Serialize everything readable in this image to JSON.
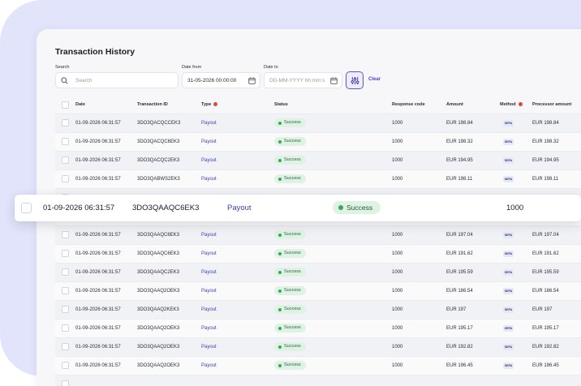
{
  "page": {
    "title": "Transaction History"
  },
  "filters": {
    "search": {
      "label": "Search",
      "placeholder": "Search"
    },
    "date_from": {
      "label": "Date from",
      "value": "31-05-2026 00:00:00"
    },
    "date_to": {
      "label": "Date to",
      "placeholder": "DD-MM-YYYY hh:mm:ss"
    },
    "clear_label": "Clear"
  },
  "table": {
    "headers": {
      "date": "Date",
      "transaction_id": "Transaction ID",
      "type": "Type",
      "status": "Status",
      "response_code": "Response code",
      "amount": "Amount",
      "method": "Method",
      "processor_amount": "Processor amount"
    },
    "rows": [
      {
        "date": "01-09-2026 06:31:57",
        "id": "3DO3QACQCCEK3",
        "type": "Payout",
        "status": "Success",
        "code": "1000",
        "amount": "EUR 198.84",
        "method": "SEPA",
        "processor": "EUR 198.84"
      },
      {
        "date": "01-09-2026 06:31:57",
        "id": "3DO3QACQC6EK3",
        "type": "Payout",
        "status": "Success",
        "code": "1000",
        "amount": "EUR 198.32",
        "method": "SEPA",
        "processor": "EUR 198.32"
      },
      {
        "date": "01-09-2026 06:31:57",
        "id": "3DO3QACQC2EK3",
        "type": "Payout",
        "status": "Success",
        "code": "1000",
        "amount": "EUR 194.95",
        "method": "SEPA",
        "processor": "EUR 194.95"
      },
      {
        "date": "01-09-2026 06:31:57",
        "id": "3DO3QABWS2EK3",
        "type": "Payout",
        "status": "Success",
        "code": "1000",
        "amount": "EUR 198.11",
        "method": "SEPA",
        "processor": "EUR 198.11"
      },
      {
        "date": "",
        "id": "",
        "type": "",
        "status": "",
        "code": "",
        "amount": "",
        "method": "",
        "processor": ""
      },
      {
        "date": "",
        "id": "",
        "type": "",
        "status": "",
        "code": "",
        "amount": "",
        "method": "",
        "processor": ""
      },
      {
        "date": "01-09-2026 06:31:57",
        "id": "3DO3QAAQC6EK3",
        "type": "Payout",
        "status": "Success",
        "code": "1000",
        "amount": "EUR 197.04",
        "method": "SEPA",
        "processor": "EUR 197.04"
      },
      {
        "date": "01-09-2026 06:31:57",
        "id": "3DO3QAAQC6EK3",
        "type": "Payout",
        "status": "Success",
        "code": "1000",
        "amount": "EUR 191.62",
        "method": "SEPA",
        "processor": "EUR 191.62"
      },
      {
        "date": "01-09-2026 06:31:57",
        "id": "3DO3QAAQC2EK3",
        "type": "Payout",
        "status": "Success",
        "code": "1000",
        "amount": "EUR 195.59",
        "method": "SEPA",
        "processor": "EUR 195.59"
      },
      {
        "date": "01-09-2026 06:31:57",
        "id": "3DO3QAAQ2OEK3",
        "type": "Payout",
        "status": "Success",
        "code": "1000",
        "amount": "EUR 186.54",
        "method": "SEPA",
        "processor": "EUR 186.54"
      },
      {
        "date": "01-09-2026 06:31:57",
        "id": "3DO3QAAQ2KEK3",
        "type": "Payout",
        "status": "Success",
        "code": "1000",
        "amount": "EUR 197",
        "method": "SEPA",
        "processor": "EUR 197"
      },
      {
        "date": "01-09-2026 06:31:57",
        "id": "3DO3QAAQ2OEK3",
        "type": "Payout",
        "status": "Success",
        "code": "1000",
        "amount": "EUR 195.17",
        "method": "SEPA",
        "processor": "EUR 195.17"
      },
      {
        "date": "01-09-2026 06:31:57",
        "id": "3DO3QAAQ2OEK3",
        "type": "Payout",
        "status": "Success",
        "code": "1000",
        "amount": "EUR 192.82",
        "method": "SEPA",
        "processor": "EUR 192.82"
      },
      {
        "date": "01-09-2026 06:31:57",
        "id": "3DO3QAAQ2OEK3",
        "type": "Payout",
        "status": "Success",
        "code": "1000",
        "amount": "EUR 196.45",
        "method": "SEPA",
        "processor": "EUR 196.45"
      },
      {
        "date": "",
        "id": "",
        "type": "",
        "status": "",
        "code": "",
        "amount": "",
        "method": "",
        "processor": ""
      }
    ]
  },
  "highlighted_row": {
    "date": "01-09-2026 06:31:57",
    "id": "3DO3QAAQC6EK3",
    "type": "Payout",
    "status": "Success",
    "code": "1000"
  },
  "icons": {
    "search": "search-icon",
    "calendar": "calendar-icon",
    "filter": "filter-sliders-icon",
    "required": "required-dot-icon",
    "method": "sepa-logo-icon"
  },
  "colors": {
    "accent": "#4b46d0",
    "success_bg": "#dff3e4",
    "success_dot": "#35a85a",
    "required_dot": "#e0453a"
  }
}
